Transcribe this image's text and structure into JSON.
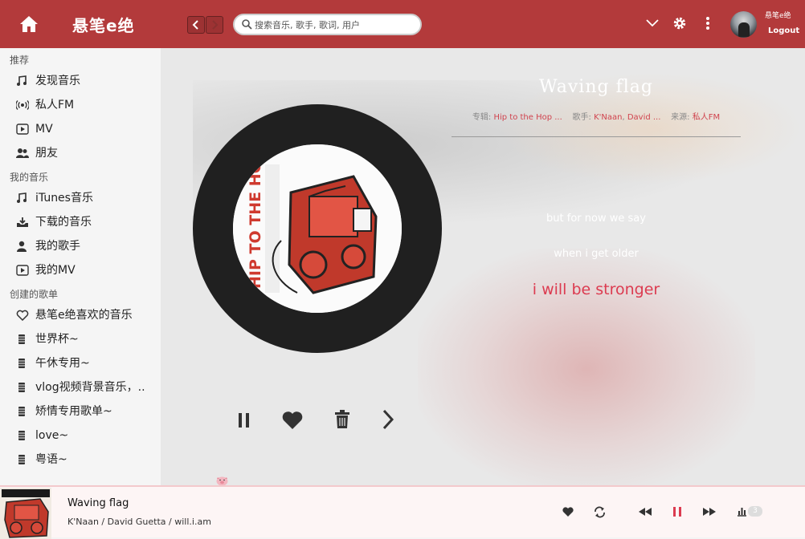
{
  "app": {
    "name": "悬笔e绝"
  },
  "search": {
    "placeholder": "搜索音乐, 歌手, 歌词, 用户"
  },
  "user": {
    "name": "悬笔e绝",
    "logout": "Logout"
  },
  "sidebar": {
    "sections": [
      {
        "title": "推荐",
        "items": [
          {
            "label": "发现音乐",
            "icon": "music-note-icon"
          },
          {
            "label": "私人FM",
            "icon": "radio-icon"
          },
          {
            "label": "MV",
            "icon": "video-icon"
          },
          {
            "label": "朋友",
            "icon": "friends-icon"
          }
        ]
      },
      {
        "title": "我的音乐",
        "items": [
          {
            "label": "iTunes音乐",
            "icon": "music-note-icon"
          },
          {
            "label": "下载的音乐",
            "icon": "download-icon"
          },
          {
            "label": "我的歌手",
            "icon": "person-icon"
          },
          {
            "label": "我的MV",
            "icon": "video-icon"
          }
        ]
      },
      {
        "title": "创建的歌单",
        "items": [
          {
            "label": "悬笔e绝喜欢的音乐",
            "icon": "heart-outline-icon"
          },
          {
            "label": "世界杯~",
            "icon": "playlist-icon"
          },
          {
            "label": "午休专用~",
            "icon": "playlist-icon"
          },
          {
            "label": "vlog视频背景音乐，..",
            "icon": "playlist-icon"
          },
          {
            "label": "矫情专用歌单~",
            "icon": "playlist-icon"
          },
          {
            "label": "love~",
            "icon": "playlist-icon"
          },
          {
            "label": "粤语~",
            "icon": "playlist-icon"
          }
        ]
      }
    ]
  },
  "song": {
    "title": "Waving flag",
    "album_label": "专辑:",
    "album": "Hip to the Hop ...",
    "artist_label": "歌手:",
    "artist1": "K'Naan",
    "artist2": "David ...",
    "source_label": "来源:",
    "source": "私人FM",
    "cover_text": "HIP TO THE HOP"
  },
  "lyrics": [
    {
      "text": "but for now we say",
      "current": false
    },
    {
      "text": "when i get older",
      "current": false
    },
    {
      "text": "i will be stronger",
      "current": true
    }
  ],
  "player": {
    "title": "Waving flag",
    "artists": [
      "K'Naan",
      "David Guetta",
      "will.i.am"
    ],
    "separator": "/",
    "queue_count": "3",
    "state": "playing"
  },
  "colors": {
    "brand": "#b33a3b",
    "accent": "#dc3b50",
    "disc": "#202020"
  }
}
